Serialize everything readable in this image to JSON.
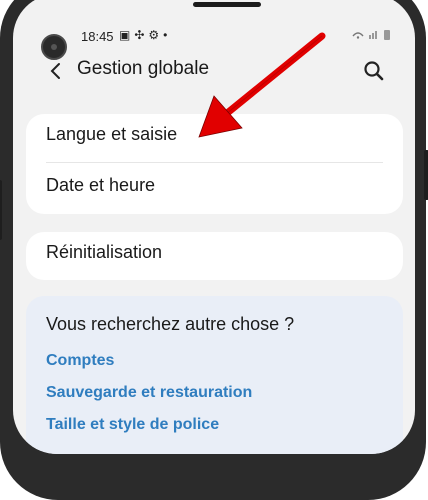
{
  "status_bar": {
    "time": "18:45",
    "icons": [
      "image-icon",
      "pinwheel-icon",
      "gear-icon",
      "dot-icon"
    ],
    "right_icons": [
      "wifi-icon",
      "signal-icon",
      "battery-icon"
    ]
  },
  "header": {
    "title": "Gestion globale",
    "back_icon": "chevron-left-icon",
    "search_icon": "search-icon"
  },
  "card1": {
    "items": [
      {
        "label": "Langue et saisie"
      },
      {
        "label": "Date et heure"
      }
    ]
  },
  "card2": {
    "items": [
      {
        "label": "Réinitialisation"
      }
    ]
  },
  "suggestions": {
    "title": "Vous recherchez autre chose ?",
    "links": [
      {
        "label": "Comptes"
      },
      {
        "label": "Sauvegarde et restauration"
      },
      {
        "label": "Taille et style de police"
      }
    ]
  },
  "colors": {
    "accent_link": "#2f7dbf",
    "annotation_arrow": "#e10000",
    "background": "#f2f2f2",
    "card": "#ffffff",
    "suggestion_card": "#e9eef7"
  }
}
